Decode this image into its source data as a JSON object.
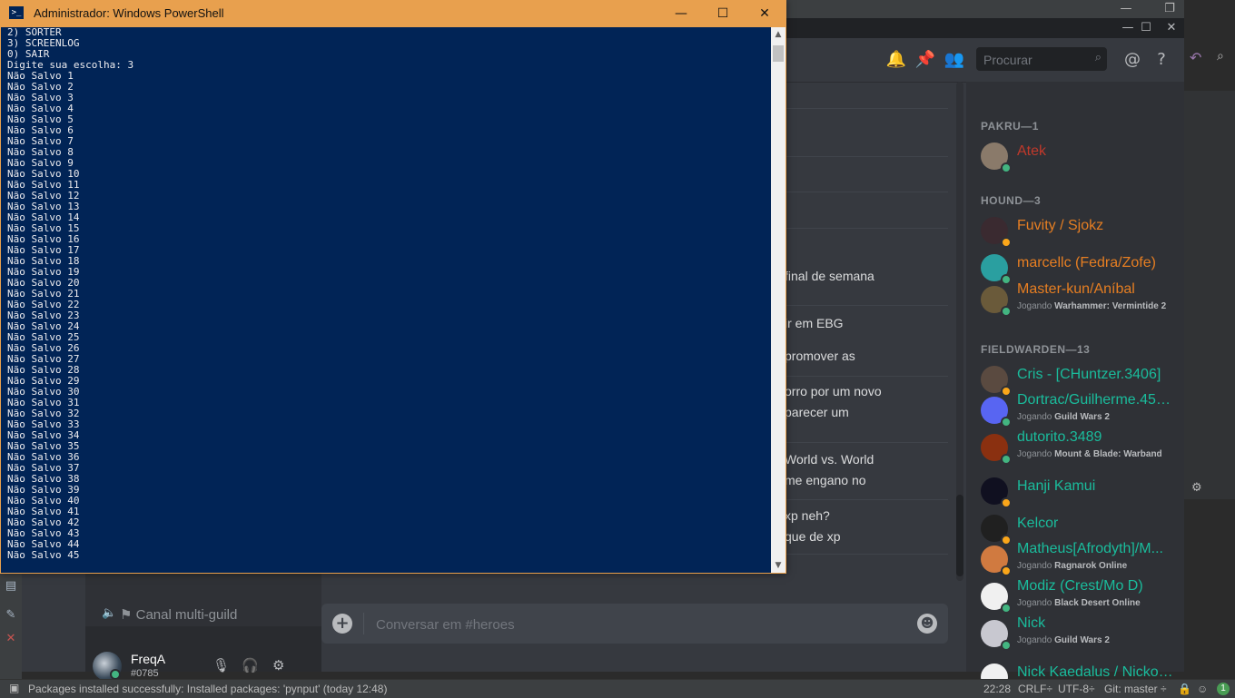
{
  "ide": {
    "status_message": "Packages installed successfully: Installed packages: 'pynput' (today 12:48)",
    "status_right": {
      "position": "22:28",
      "line_ending": "CRLF÷",
      "encoding": "UTF-8÷",
      "git": "Git: master ÷"
    }
  },
  "discord": {
    "search_placeholder": "Procurar",
    "channel_voice": "Canal multi-guild",
    "user": {
      "name": "FreqA",
      "tag": "#0785"
    },
    "message_placeholder": "Conversar em #heroes",
    "messages": [
      "final de semana",
      "ir em EBG",
      "promover as",
      "orro por um novo",
      "parecer um",
      "World vs. World",
      "me engano no",
      "xp neh?",
      "que de xp"
    ],
    "member_groups": [
      {
        "title": "PAKRU—1"
      },
      {
        "title": "HOUND—3"
      },
      {
        "title": "FIELDWARDEN—13"
      }
    ],
    "members": [
      {
        "name": "Atek",
        "color": "#c0392b",
        "status": "online",
        "activity_prefix": "",
        "activity": ""
      },
      {
        "name": "Fuvity / Sjokz",
        "color": "#e67e22",
        "status": "idle",
        "activity_prefix": "",
        "activity": ""
      },
      {
        "name": "marcellc (Fedra/Zofe)",
        "color": "#e67e22",
        "status": "online",
        "activity_prefix": "",
        "activity": ""
      },
      {
        "name": "Master-kun/Aníbal",
        "color": "#e67e22",
        "status": "online",
        "activity_prefix": "Jogando",
        "activity": "Warhammer: Vermintide 2"
      },
      {
        "name": "Cris - [CHuntzer.3406]",
        "color": "#1abc9c",
        "status": "idle",
        "activity_prefix": "",
        "activity": ""
      },
      {
        "name": "Dortrac/Guilherme.453...",
        "color": "#1abc9c",
        "status": "online",
        "activity_prefix": "Jogando",
        "activity": "Guild Wars 2"
      },
      {
        "name": "dutorito.3489",
        "color": "#1abc9c",
        "status": "online",
        "activity_prefix": "Jogando",
        "activity": "Mount & Blade: Warband"
      },
      {
        "name": "Hanji Kamui",
        "color": "#1abc9c",
        "status": "idle",
        "activity_prefix": "",
        "activity": ""
      },
      {
        "name": "Kelcor",
        "color": "#1abc9c",
        "status": "idle",
        "activity_prefix": "",
        "activity": ""
      },
      {
        "name": "Matheus[Afrodyth]/M...",
        "color": "#1abc9c",
        "status": "idle",
        "activity_prefix": "Jogando",
        "activity": "Ragnarok Online"
      },
      {
        "name": "Modiz (Crest/Mo D)",
        "color": "#1abc9c",
        "status": "online",
        "activity_prefix": "Jogando",
        "activity": "Black Desert Online"
      },
      {
        "name": "Nick",
        "color": "#1abc9c",
        "status": "online",
        "activity_prefix": "Jogando",
        "activity": "Guild Wars 2"
      },
      {
        "name": "Nick Kaedalus / Nickolas",
        "color": "#1abc9c",
        "status": "idle",
        "activity_prefix": "",
        "activity": ""
      }
    ]
  },
  "powershell": {
    "title": "Administrador: Windows PowerShell",
    "lines": [
      "2) SORTER",
      "3) SCREENLOG",
      "0) SAIR",
      "Digite sua escolha: 3",
      "Não Salvo 1",
      "Não Salvo 2",
      "Não Salvo 3",
      "Não Salvo 4",
      "Não Salvo 5",
      "Não Salvo 6",
      "Não Salvo 7",
      "Não Salvo 8",
      "Não Salvo 9",
      "Não Salvo 10",
      "Não Salvo 11",
      "Não Salvo 12",
      "Não Salvo 13",
      "Não Salvo 14",
      "Não Salvo 15",
      "Não Salvo 16",
      "Não Salvo 17",
      "Não Salvo 18",
      "Não Salvo 19",
      "Não Salvo 20",
      "Não Salvo 21",
      "Não Salvo 22",
      "Não Salvo 23",
      "Não Salvo 24",
      "Não Salvo 25",
      "Não Salvo 26",
      "Não Salvo 27",
      "Não Salvo 28",
      "Não Salvo 29",
      "Não Salvo 30",
      "Não Salvo 31",
      "Não Salvo 32",
      "Não Salvo 33",
      "Não Salvo 34",
      "Não Salvo 35",
      "Não Salvo 36",
      "Não Salvo 37",
      "Não Salvo 38",
      "Não Salvo 39",
      "Não Salvo 40",
      "Não Salvo 41",
      "Não Salvo 42",
      "Não Salvo 43",
      "Não Salvo 44",
      "Não Salvo 45"
    ]
  }
}
